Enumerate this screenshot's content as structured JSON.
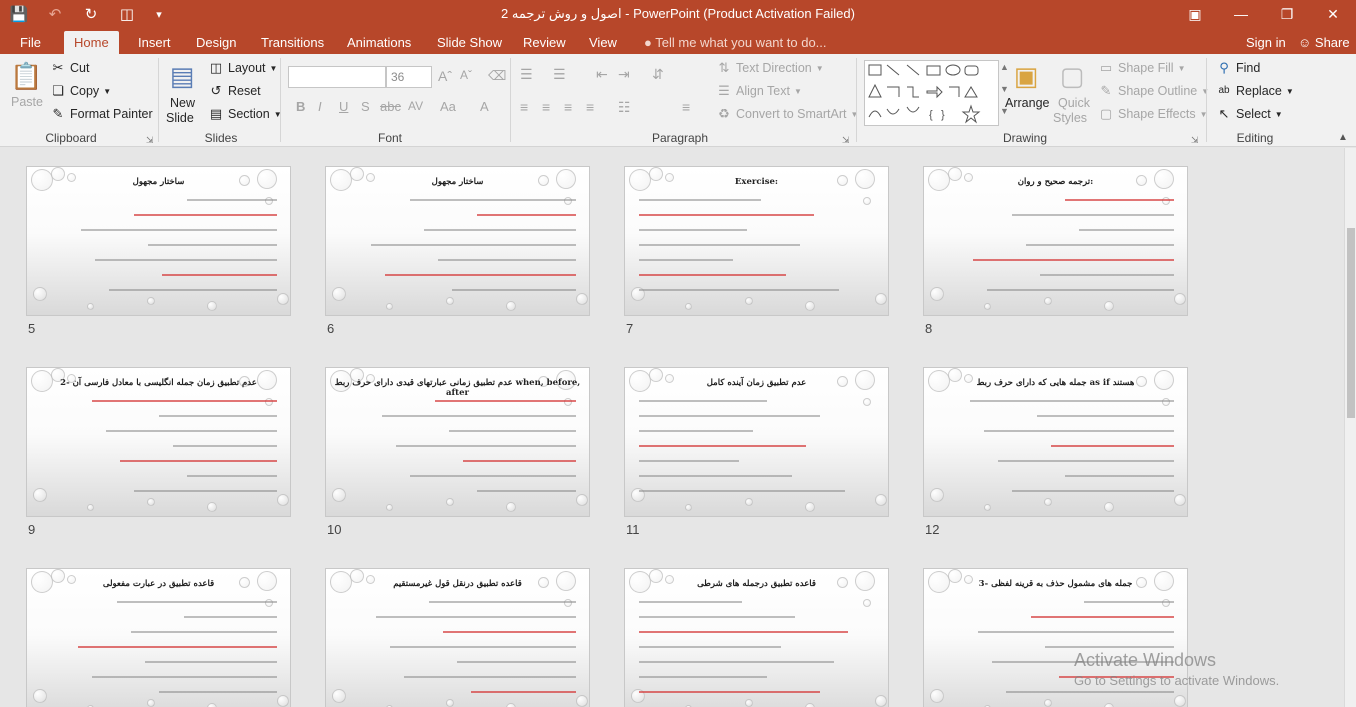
{
  "window": {
    "title": "اصول و روش ترجمه 2 - PowerPoint (Product Activation Failed)",
    "accent": "#b7472a"
  },
  "quick_access": [
    "save-icon",
    "undo-icon",
    "redo-icon",
    "start-slideshow-icon",
    "customize-icon"
  ],
  "tabs": [
    "File",
    "Home",
    "Insert",
    "Design",
    "Transitions",
    "Animations",
    "Slide Show",
    "Review",
    "View"
  ],
  "active_tab": "Home",
  "tell_me": "Tell me what you want to do...",
  "account": {
    "sign_in": "Sign in",
    "share": "Share"
  },
  "ribbon": {
    "clipboard": {
      "label": "Clipboard",
      "paste": "Paste",
      "cut": "Cut",
      "copy": "Copy",
      "format_painter": "Format Painter"
    },
    "slides": {
      "label": "Slides",
      "new_slide_1": "New",
      "new_slide_2": "Slide",
      "layout": "Layout",
      "reset": "Reset",
      "section": "Section"
    },
    "font": {
      "label": "Font",
      "font_name": "",
      "font_size": "36"
    },
    "paragraph": {
      "label": "Paragraph",
      "text_direction": "Text Direction",
      "align_text": "Align Text",
      "convert_smartart": "Convert to SmartArt"
    },
    "drawing": {
      "label": "Drawing",
      "arrange": "Arrange",
      "quick_styles_1": "Quick",
      "quick_styles_2": "Styles",
      "shape_fill": "Shape Fill",
      "shape_outline": "Shape Outline",
      "shape_effects": "Shape Effects"
    },
    "editing": {
      "label": "Editing",
      "find": "Find",
      "replace": "Replace",
      "select": "Select"
    }
  },
  "slides": [
    {
      "number": "5",
      "title": "ساختار مجهول"
    },
    {
      "number": "6",
      "title": "ساختار مجهول"
    },
    {
      "number": "7",
      "title": "Exercise:"
    },
    {
      "number": "8",
      "title": "ترجمه صحیح و روان:"
    },
    {
      "number": "9",
      "title": "2-  عدم تطبیق زمان جمله انگلیسی با معادل فارسی آن"
    },
    {
      "number": "10",
      "title": "عدم تطبیق زمانی عبارتهای قیدی دارای حرف ربط when, before, after"
    },
    {
      "number": "11",
      "title": "عدم تطبیق زمان آینده کامل"
    },
    {
      "number": "12",
      "title": "جمله هایی که دارای حرف ربط as if هستند"
    },
    {
      "number": "",
      "title": "قاعده تطبیق در عبارت مفعولی"
    },
    {
      "number": "",
      "title": "قاعده تطبیق درنقل قول غیرمستقیم"
    },
    {
      "number": "",
      "title": "قاعده تطبیق درجمله های شرطی"
    },
    {
      "number": "",
      "title": "3- جمله های مشمول حذف به قرینه لفظی"
    }
  ],
  "watermark": {
    "line1": "Activate Windows",
    "line2": "Go to Settings to activate Windows."
  }
}
